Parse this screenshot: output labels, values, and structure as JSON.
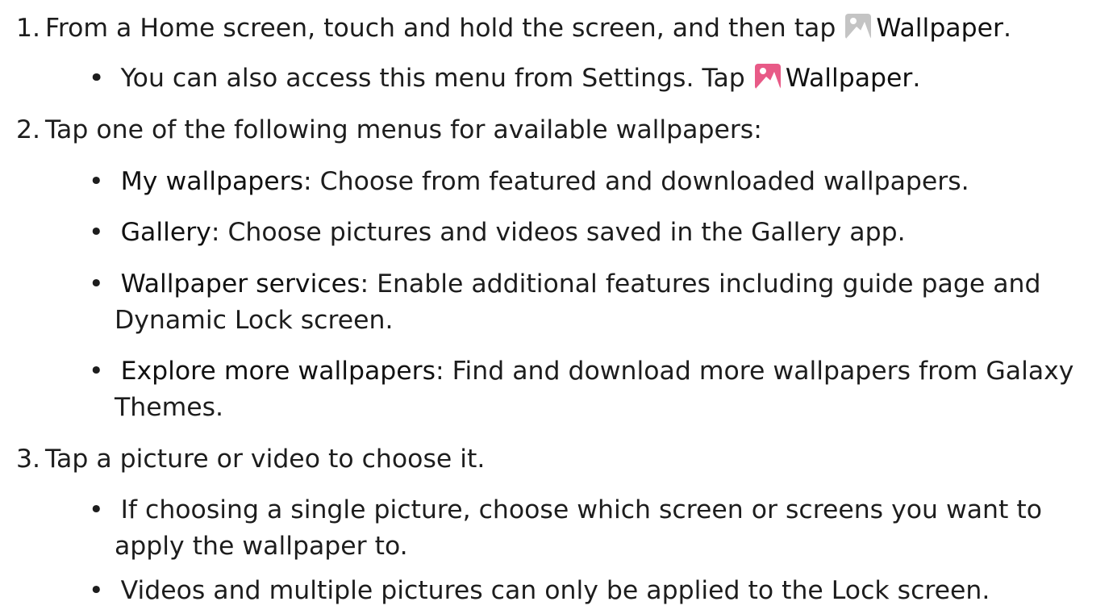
{
  "steps": [
    {
      "number": "1.",
      "text_before": "From a Home screen, touch and hold the screen, and then tap",
      "icon": "wallpaper-gray-icon",
      "term": "Wallpaper",
      "text_after": ".",
      "bullets": [
        {
          "text_before": "You can also access this menu from Settings. Tap",
          "icon": "wallpaper-pink-icon",
          "term": "Wallpaper",
          "text_after": "."
        }
      ]
    },
    {
      "number": "2.",
      "text": "Tap one of the following menus for available wallpapers:",
      "bullets": [
        {
          "term": "My wallpapers",
          "text_after": ": Choose from featured and downloaded wallpapers."
        },
        {
          "term": "Gallery",
          "text_after": ": Choose pictures and videos saved in the Gallery app."
        },
        {
          "term": "Wallpaper services",
          "text_after": ": Enable additional features including guide page and",
          "line2": "Dynamic Lock screen."
        },
        {
          "term": "Explore more wallpapers",
          "text_after": ": Find and download more wallpapers from Galaxy",
          "line2": "Themes."
        }
      ]
    },
    {
      "number": "3.",
      "text": "Tap a picture or video to choose it.",
      "bullets": [
        {
          "text": "If choosing a single picture, choose which screen or screens you want to",
          "line2": "apply the wallpaper to."
        },
        {
          "text": "Videos and multiple pictures can only be applied to the Lock screen."
        }
      ]
    }
  ],
  "colors": {
    "text": "#1d1d1d",
    "icon_gray": "#c4c4c4",
    "icon_pink": "#e85a87"
  }
}
